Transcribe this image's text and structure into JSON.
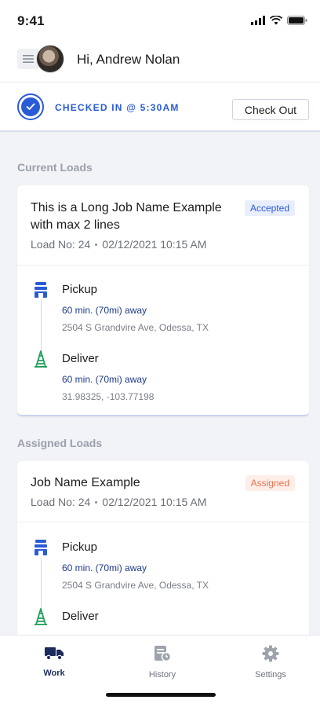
{
  "status_bar": {
    "time": "9:41"
  },
  "header": {
    "greeting": "Hi, Andrew Nolan"
  },
  "checkin": {
    "status_text": "CHECKED IN @ 5:30AM",
    "checkout_label": "Check Out"
  },
  "sections": {
    "current": "Current Loads",
    "assigned": "Assigned Loads"
  },
  "current_load": {
    "job_name": "This is a Long Job Name Example with max 2 lines",
    "status": "Accepted",
    "load_no": "Load No: 24",
    "datetime": "02/12/2021 10:15 AM",
    "pickup": {
      "title": "Pickup",
      "eta": "60 min. (70mi) away",
      "address": "2504 S Grandvire Ave, Odessa, TX"
    },
    "deliver": {
      "title": "Deliver",
      "eta": "60 min. (70mi) away",
      "address": "31.98325, -103.77198"
    }
  },
  "assigned_load": {
    "job_name": "Job Name Example",
    "status": "Assigned",
    "load_no": "Load No: 24",
    "datetime": "02/12/2021 10:15 AM",
    "pickup": {
      "title": "Pickup",
      "eta": "60 min. (70mi) away",
      "address": "2504 S Grandvire Ave, Odessa, TX"
    },
    "deliver": {
      "title": "Deliver"
    }
  },
  "tabs": [
    {
      "label": "Work",
      "icon": "truck-icon",
      "active": true
    },
    {
      "label": "History",
      "icon": "document-clock-icon",
      "active": false
    },
    {
      "label": "Settings",
      "icon": "gear-icon",
      "active": false
    }
  ],
  "colors": {
    "primary": "#2a5bd7",
    "navy": "#1b2b5c",
    "accepted_bg": "#e8eefc",
    "assigned": "#e8744f",
    "deliver_icon": "#1e9e57"
  }
}
